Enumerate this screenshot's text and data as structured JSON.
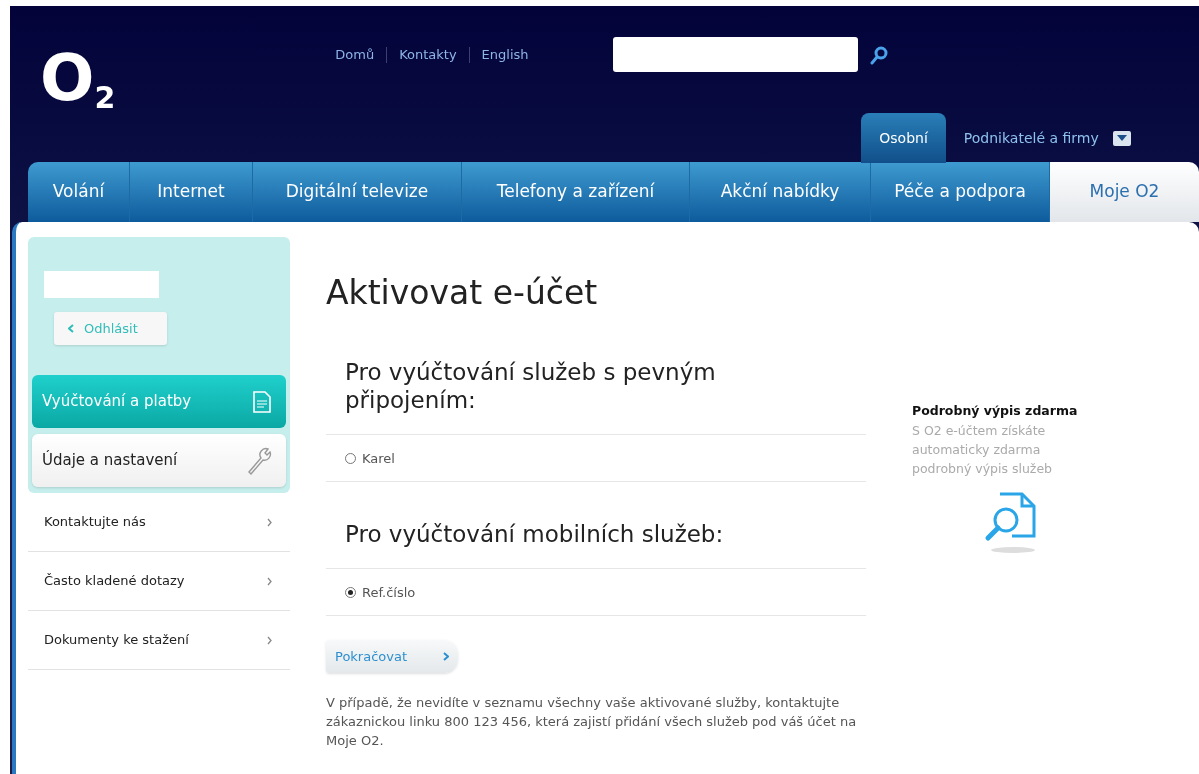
{
  "logo": "O$_{2}$",
  "top_links": [
    "Domů",
    "Kontakty",
    "English"
  ],
  "segments": [
    {
      "label": "Osobní",
      "selected": true
    },
    {
      "label": "Podnikatelé a firmy",
      "selected": false,
      "dropdown": true
    }
  ],
  "nav": [
    {
      "label": "Volání",
      "selected": false
    },
    {
      "label": "Internet",
      "selected": false
    },
    {
      "label": "Digitální televize",
      "selected": false
    },
    {
      "label": "Telefony a zařízení",
      "selected": false
    },
    {
      "label": "Akční nabídky",
      "selected": false
    },
    {
      "label": "Péče a podpora",
      "selected": false
    },
    {
      "label": "Moje O2",
      "selected": true
    }
  ],
  "sidebar": {
    "logout": "Odhlásit",
    "account_items": [
      {
        "label": "Vyúčtování a platby",
        "selected": true,
        "kind": "document"
      },
      {
        "label": "Údaje a nastavení",
        "selected": false,
        "kind": "wrench"
      }
    ],
    "links": [
      "Kontaktujte nás",
      "Často kladené dotazy",
      "Dokumenty ke stažení"
    ]
  },
  "title": "Aktivovat e-účet",
  "sections": [
    {
      "heading": "Pro vyúčtování služeb s pevným připojením:",
      "options": [
        {
          "label": "Karel",
          "selected": false
        }
      ]
    },
    {
      "heading": "Pro vyúčtování mobilních služeb:",
      "options": [
        {
          "label": "Ref.číslo",
          "selected": true
        }
      ]
    }
  ],
  "continue_button": "Pokračovat",
  "note": "V případě, že nevidíte v seznamu všechny vaše aktivované služby, kontaktujte zákaznickou linku 800 123 456, která zajistí přidání všech služeb pod váš účet na Moje O2.",
  "promo": {
    "title": "Podrobný výpis zdarma",
    "text": "S O2 e-účtem získáte automaticky zdarma podrobný výpis služeb"
  }
}
